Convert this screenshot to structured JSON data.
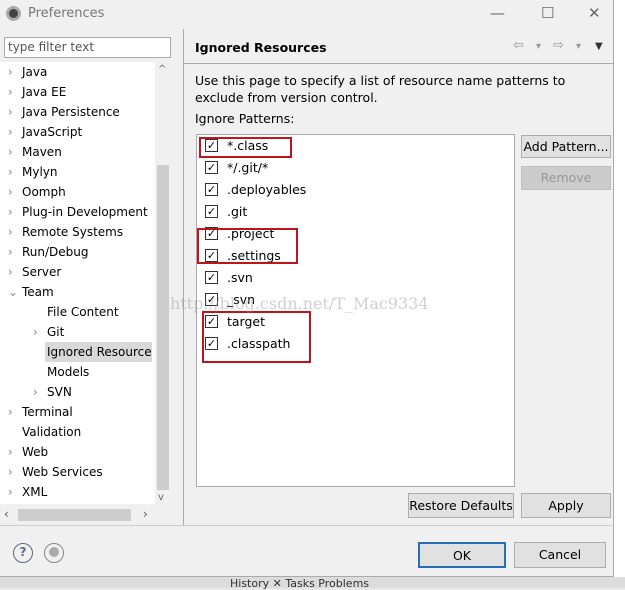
{
  "window": {
    "title": "Preferences",
    "minimize": "—",
    "maximize": "☐",
    "close": "✕"
  },
  "filter": {
    "placeholder": "type filter text"
  },
  "tree": [
    {
      "label": "Java",
      "level": 0,
      "expander": "›"
    },
    {
      "label": "Java EE",
      "level": 0,
      "expander": "›"
    },
    {
      "label": "Java Persistence",
      "level": 0,
      "expander": "›"
    },
    {
      "label": "JavaScript",
      "level": 0,
      "expander": "›"
    },
    {
      "label": "Maven",
      "level": 0,
      "expander": "›"
    },
    {
      "label": "Mylyn",
      "level": 0,
      "expander": "›"
    },
    {
      "label": "Oomph",
      "level": 0,
      "expander": "›"
    },
    {
      "label": "Plug-in Development",
      "level": 0,
      "expander": "›"
    },
    {
      "label": "Remote Systems",
      "level": 0,
      "expander": "›"
    },
    {
      "label": "Run/Debug",
      "level": 0,
      "expander": "›"
    },
    {
      "label": "Server",
      "level": 0,
      "expander": "›"
    },
    {
      "label": "Team",
      "level": 0,
      "expander": "⌄"
    },
    {
      "label": "File Content",
      "level": 1,
      "expander": ""
    },
    {
      "label": "Git",
      "level": 1,
      "expander": "›"
    },
    {
      "label": "Ignored Resource",
      "level": 1,
      "expander": "",
      "selected": true
    },
    {
      "label": "Models",
      "level": 1,
      "expander": ""
    },
    {
      "label": "SVN",
      "level": 1,
      "expander": "›"
    },
    {
      "label": "Terminal",
      "level": 0,
      "expander": "›"
    },
    {
      "label": "Validation",
      "level": 0,
      "expander": ""
    },
    {
      "label": "Web",
      "level": 0,
      "expander": "›"
    },
    {
      "label": "Web Services",
      "level": 0,
      "expander": "›"
    },
    {
      "label": "XML",
      "level": 0,
      "expander": "›"
    }
  ],
  "page": {
    "title": "Ignored Resources",
    "description": "Use this page to specify a list of resource name patterns to exclude from version control.",
    "patterns_label": "Ignore Patterns:"
  },
  "patterns": [
    {
      "text": "*.class",
      "checked": true
    },
    {
      "text": "*/.git/*",
      "checked": true
    },
    {
      "text": ".deployables",
      "checked": true
    },
    {
      "text": ".git",
      "checked": true
    },
    {
      "text": ".project",
      "checked": true
    },
    {
      "text": ".settings",
      "checked": true
    },
    {
      "text": ".svn",
      "checked": true
    },
    {
      "text": "_svn",
      "checked": true
    },
    {
      "text": "target",
      "checked": true
    },
    {
      "text": ".classpath",
      "checked": true
    }
  ],
  "buttons": {
    "add_pattern": "Add Pattern...",
    "remove": "Remove",
    "restore_defaults": "Restore Defaults",
    "apply": "Apply",
    "ok": "OK",
    "cancel": "Cancel"
  },
  "icons": {
    "help": "?",
    "back": "⇦",
    "forward": "⇨",
    "dropdown": "▾",
    "menu": "▼"
  },
  "watermark": "http://blog.csdn.net/T_Mac9334",
  "colors": {
    "highlight": "#c0141c",
    "ok_border": "#2a6db5"
  },
  "background": {
    "tabs": "History ✕   Tasks   Problems"
  }
}
